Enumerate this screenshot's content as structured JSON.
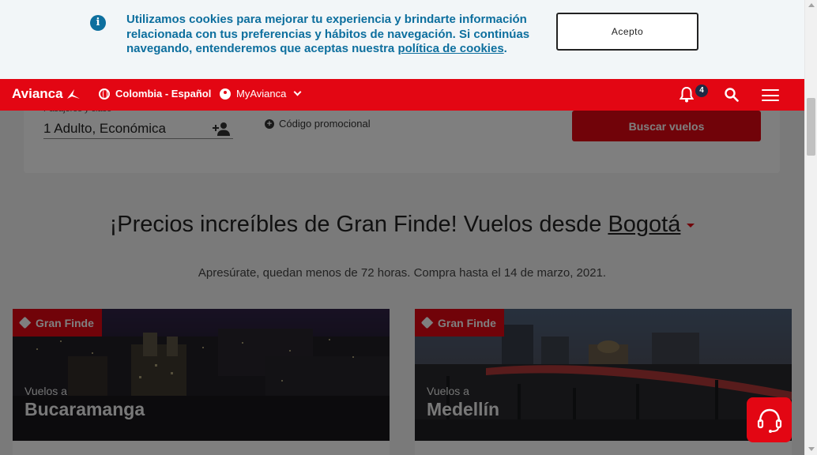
{
  "cookie_banner": {
    "text": "Utilizamos cookies para mejorar tu experiencia y brindarte información relacionada con tus preferencias y hábitos de navegación. Si continúas navegando, entenderemos que aceptas nuestra ",
    "link": "política de cookies",
    "text_end": ".",
    "accept_label": "Acepto"
  },
  "nav": {
    "logo": "Avianca",
    "country": "Colombia - Español",
    "account": "MyAvianca",
    "notifications_count": "4"
  },
  "search": {
    "passengers_label": "Pasajeros y clase",
    "passengers_value": "1 Adulto, Económica",
    "promo_label": "Código promocional",
    "submit_label": "Buscar vuelos"
  },
  "promo_section": {
    "headline_prefix": "¡Precios increíbles de Gran Finde! Vuelos desde ",
    "origin": "Bogotá",
    "subline": "Apresúrate, quedan menos de 72 horas. Compra hasta el 14 de marzo, 2021."
  },
  "destinations": [
    {
      "tag": "Gran Finde",
      "pre": "Vuelos a",
      "city": "Bucaramanga"
    },
    {
      "tag": "Gran Finde",
      "pre": "Vuelos a",
      "city": "Medellín"
    }
  ],
  "colors": {
    "brand_red": "#e30613",
    "cookie_blue": "#0d6f9e",
    "badge_navy": "#202a44"
  }
}
